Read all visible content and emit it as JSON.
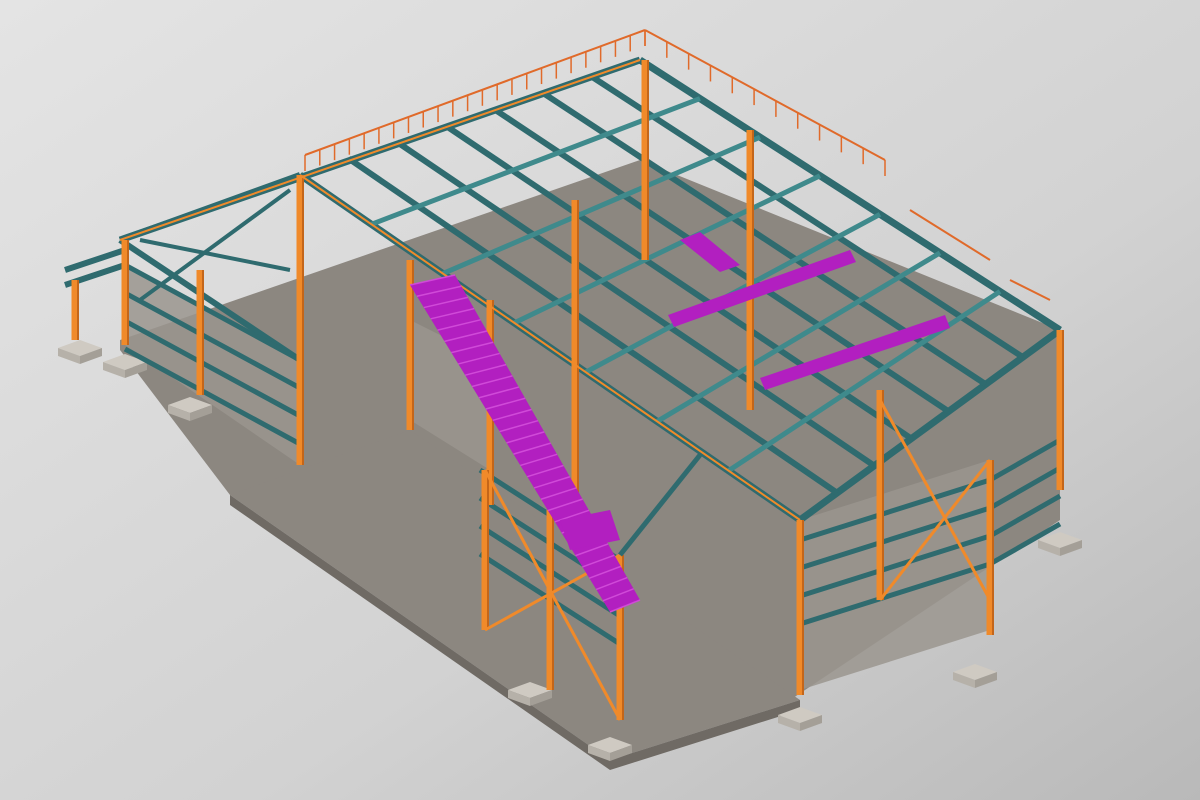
{
  "scene": {
    "subject": "steel-frame-building-3d-model",
    "colors": {
      "background_light": "#dedede",
      "background_dark": "#bdbdbd",
      "slab": "#8c8780",
      "slab_edge": "#6f6a64",
      "footing": "#cfcac2",
      "column": "#f08a2a",
      "column_dark": "#c4661a",
      "beam": "#2f6b6f",
      "beam_light": "#3f8a8c",
      "stair": "#b21fc0",
      "stair_light": "#d04ad8",
      "railing": "#e06a2a",
      "wall": "#9a958e"
    }
  }
}
